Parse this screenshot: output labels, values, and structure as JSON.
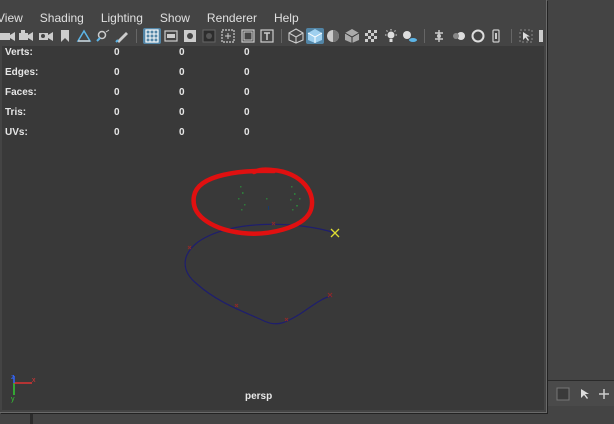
{
  "menu": {
    "items": [
      "View",
      "Shading",
      "Lighting",
      "Show",
      "Renderer",
      "Help"
    ]
  },
  "toolbar": {
    "icons": [
      "camera-select-icon",
      "camera-attributes-icon",
      "bookmark-icon",
      "image-plane-icon",
      "2d-pan-zoom-icon",
      "grease-pencil-icon",
      "grid-icon",
      "film-gate-icon",
      "resolution-gate-icon",
      "gate-mask-icon",
      "field-chart-icon",
      "safe-title-icon",
      "wireframe-icon",
      "smooth-shade-icon",
      "use-default-material-icon",
      "wireframe-on-shaded-icon",
      "textured-icon",
      "lights-icon",
      "shadows-icon",
      "screen-space-ao-icon",
      "motion-blur-icon",
      "anti-aliasing-icon",
      "isolate-select-icon",
      "xray-icon"
    ]
  },
  "hud": {
    "rows": [
      {
        "label": "Verts:",
        "values": [
          "0",
          "0",
          "0"
        ]
      },
      {
        "label": "Edges:",
        "values": [
          "0",
          "0",
          "0"
        ]
      },
      {
        "label": "Faces:",
        "values": [
          "0",
          "0",
          "0"
        ]
      },
      {
        "label": "Tris:",
        "values": [
          "0",
          "0",
          "0"
        ]
      },
      {
        "label": "UVs:",
        "values": [
          "0",
          "0",
          "0"
        ]
      }
    ]
  },
  "viewport": {
    "camera": "persp",
    "axis": {
      "x": "x",
      "y": "y",
      "z": "z"
    }
  },
  "colors": {
    "viewport_bg": "#393939",
    "panel_bg": "#444444",
    "curve": "#1e1e6e",
    "annotation": "#e01010",
    "locator": "#dddd33",
    "active_icon": "#5285a6"
  }
}
